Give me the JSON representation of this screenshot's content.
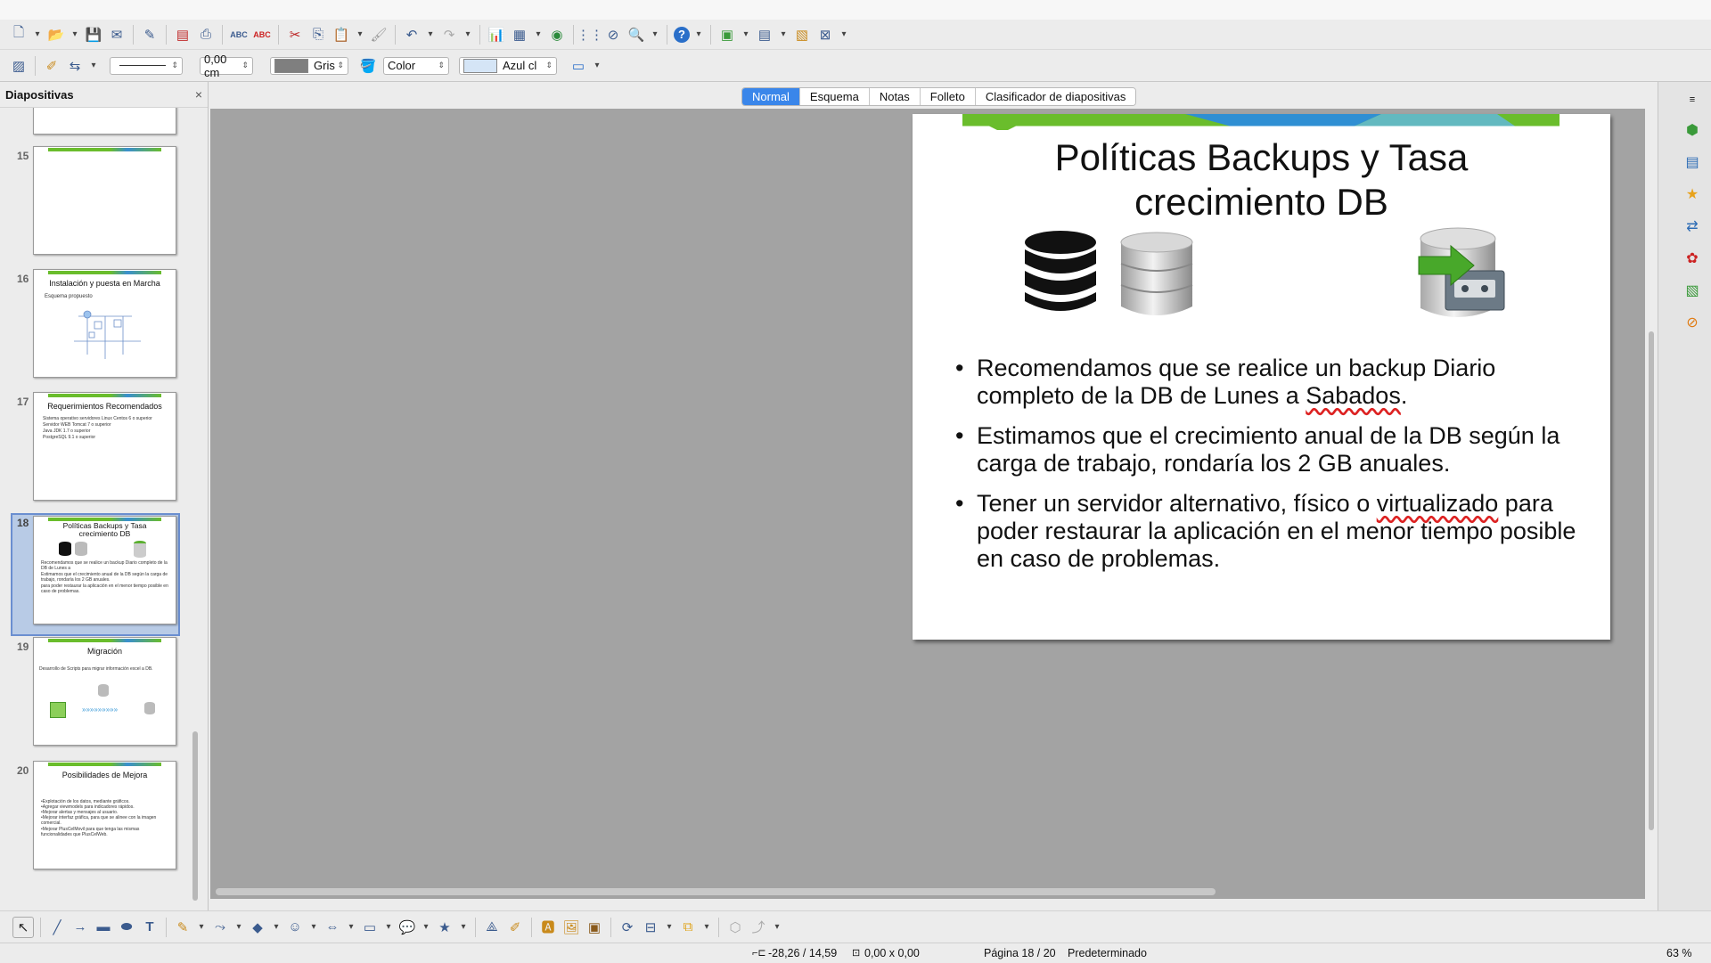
{
  "toolbar1": {
    "icons": [
      "new-icon",
      "open-icon",
      "save-icon",
      "email-icon",
      "edit-file-icon",
      "export-pdf-icon",
      "print-icon",
      "spellcheck-icon",
      "autospell-icon",
      "cut-icon",
      "copy-icon",
      "paste-icon",
      "clone-format-icon",
      "undo-icon",
      "redo-icon",
      "chart-icon",
      "table-icon",
      "fontwork-icon",
      "grid-icon",
      "navigator-icon",
      "zoom-icon",
      "help-icon",
      "slide-icon",
      "layout-icon",
      "display-icon",
      "close-presentation-icon"
    ]
  },
  "toolbar2": {
    "line_width": "0,00 cm",
    "line_color": "Gris",
    "area_style": "Color",
    "area_color": "Azul cl",
    "line_color_hex": "#7f7f7f",
    "area_color_hex": "#d5e5f6"
  },
  "slides_panel": {
    "title": "Diapositivas",
    "close": "×",
    "thumbnails": [
      {
        "num": "15",
        "title": ""
      },
      {
        "num": "16",
        "title": "Instalación y puesta en Marcha",
        "sub": "Esquema propuesto"
      },
      {
        "num": "17",
        "title": "Requerimientos Recomendados",
        "items": [
          "Sistema operativo servidores Linux Centos 6 o superior",
          "Servidor WEB Tomcat 7 o superior",
          "Java JDK 1.7 o superior",
          "PostgreSQL 9.1 o superior"
        ]
      },
      {
        "num": "18",
        "title": "Políticas Backups y Tasa crecimiento DB",
        "selected": true
      },
      {
        "num": "19",
        "title": "Migración",
        "sub": "Desarrollo de Scripts para migrar información excel a DB."
      },
      {
        "num": "20",
        "title": "Posibilidades de Mejora",
        "items": [
          "•Explotación de los datos, mediante gráficos.",
          "•Agregar viewmodels para indicadores rápidos.",
          "•Mejorar alertas y mensajes al usuario.",
          "•Mejorar interfaz gráfica, para que se alinee con la imagen comercial.",
          "•Mejorar PlusCelMovil para que tenga las mismas funcionalidades que PlusCelWeb."
        ]
      }
    ]
  },
  "view_tabs": [
    "Normal",
    "Esquema",
    "Notas",
    "Folleto",
    "Clasificador de diapositivas"
  ],
  "active_tab": "Normal",
  "slide": {
    "title_line1": "Políticas Backups y Tasa",
    "title_line2": "crecimiento DB",
    "bullets": [
      {
        "a": "Recomendamos que se realice un backup Diario completo de la DB de Lunes a ",
        "sq": "Sabados",
        "b": "."
      },
      {
        "a": "Estimamos que el crecimiento anual de la DB según la carga de trabajo, rondaría los 2 GB anuales.",
        "sq": "",
        "b": ""
      },
      {
        "a": "Tener un servidor alternativo, físico o ",
        "sq": "virtualizado",
        "b": " para poder restaurar la aplicación en el menor tiempo posible en caso de problemas."
      }
    ],
    "band_green": "#6abd2c",
    "band_blue": "#2f8fd3"
  },
  "status": {
    "position": "-28,26 / 14,59",
    "size": "0,00 x 0,00",
    "page": "Página 18 / 20",
    "layout": "Predeterminado",
    "zoom": "63 %"
  }
}
